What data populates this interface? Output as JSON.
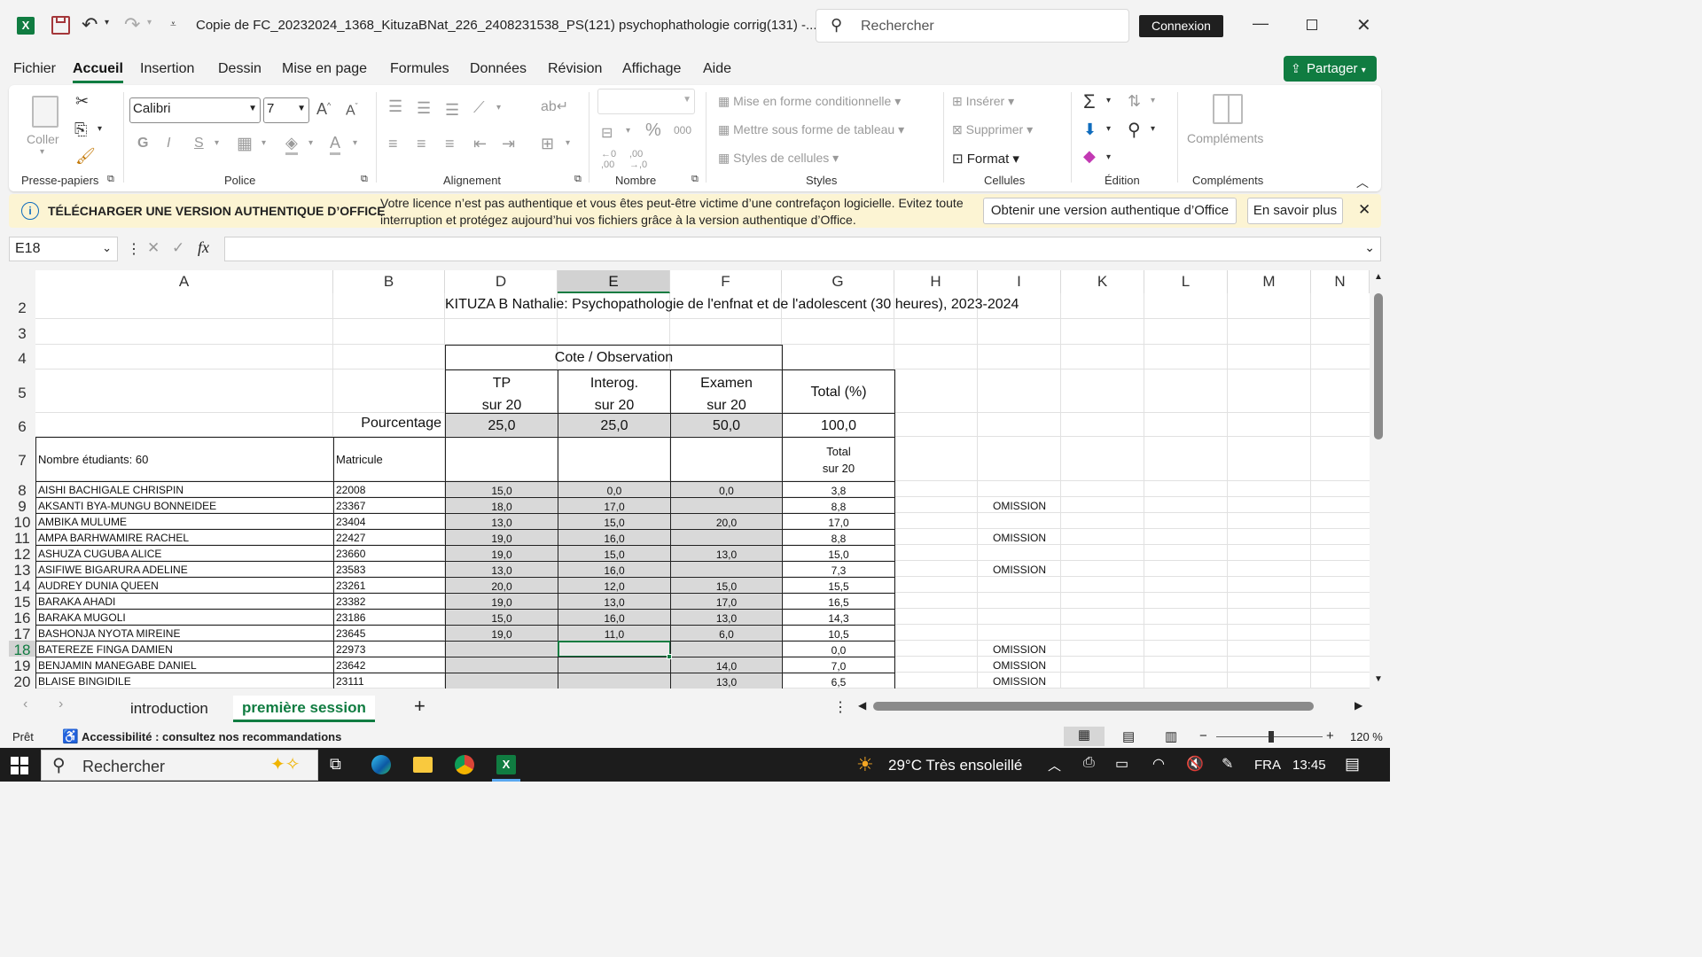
{
  "app": {
    "title": "Copie de FC_20232024_1368_KituzaBNat_226_2408231538_PS(121) psychophathologie corrig(131)  -...",
    "search_placeholder": "Rechercher",
    "signin": "Connexion"
  },
  "menu": [
    "Fichier",
    "Accueil",
    "Insertion",
    "Dessin",
    "Mise en page",
    "Formules",
    "Données",
    "Révision",
    "Affichage",
    "Aide"
  ],
  "share": "Partager",
  "ribbon": {
    "paste": "Coller",
    "font_name": "Calibri",
    "font_size": "7",
    "cond_format": "Mise en forme conditionnelle",
    "table_format": "Mettre sous forme de tableau",
    "cell_styles": "Styles de cellules",
    "insert": "Insérer",
    "delete": "Supprimer",
    "format": "Format",
    "addins": "Compléments",
    "groups": {
      "clipboard": "Presse-papiers",
      "font": "Police",
      "alignment": "Alignement",
      "number": "Nombre",
      "styles": "Styles",
      "cells": "Cellules",
      "editing": "Édition",
      "addins": "Compléments"
    }
  },
  "notice": {
    "title": "TÉLÉCHARGER UNE VERSION AUTHENTIQUE D’OFFICE",
    "message": "Votre licence n’est pas authentique et vous êtes peut-être victime d’une contrefaçon logicielle. Evitez toute interruption et protégez aujourd’hui vos fichiers grâce à la version authentique d’Office.",
    "btn_get": "Obtenir une version authentique d’Office",
    "btn_more": "En savoir plus"
  },
  "namebox": "E18",
  "columns": [
    "A",
    "B",
    "D",
    "E",
    "F",
    "G",
    "H",
    "I",
    "K",
    "L",
    "M",
    "N"
  ],
  "row_numbers": [
    "2",
    "3",
    "4",
    "5",
    "6",
    "7",
    "8",
    "9",
    "10",
    "11",
    "12",
    "13",
    "14",
    "15",
    "16",
    "17",
    "18",
    "19",
    "20"
  ],
  "sheet": {
    "title": "KITUZA B Nathalie: Psychopathologie de l'enfnat et de l'adolescent (30 heures), 2023-2024",
    "cote_header": "Cote / Observation",
    "tp_1": "TP",
    "tp_2": "sur 20",
    "interog_1": "Interog.",
    "interog_2": "sur 20",
    "examen_1": "Examen",
    "examen_2": "sur 20",
    "total_pct": "Total (%)",
    "pourcentage_label": "Pourcentage",
    "pct_tp": "25,0",
    "pct_interog": "25,0",
    "pct_examen": "50,0",
    "pct_total": "100,0",
    "nb_etudiants": "Nombre étudiants: 60",
    "matricule": "Matricule",
    "total_1": "Total",
    "total_2": "sur 20",
    "students": [
      {
        "name": "AISHI BACHIGALE CHRISPIN",
        "mat": "22008",
        "tp": "15,0",
        "int": "0,0",
        "ex": "0,0",
        "tot": "3,8",
        "obs": ""
      },
      {
        "name": "AKSANTI BYA-MUNGU BONNEIDEE",
        "mat": "23367",
        "tp": "18,0",
        "int": "17,0",
        "ex": "",
        "tot": "8,8",
        "obs": "OMISSION"
      },
      {
        "name": "AMBIKA MULUME",
        "mat": "23404",
        "tp": "13,0",
        "int": "15,0",
        "ex": "20,0",
        "tot": "17,0",
        "obs": ""
      },
      {
        "name": "AMPA BARHWAMIRE RACHEL",
        "mat": "22427",
        "tp": "19,0",
        "int": "16,0",
        "ex": "",
        "tot": "8,8",
        "obs": "OMISSION"
      },
      {
        "name": "ASHUZA CUGUBA ALICE",
        "mat": "23660",
        "tp": "19,0",
        "int": "15,0",
        "ex": "13,0",
        "tot": "15,0",
        "obs": ""
      },
      {
        "name": "ASIFIWE BIGARURA ADELINE",
        "mat": "23583",
        "tp": "13,0",
        "int": "16,0",
        "ex": "",
        "tot": "7,3",
        "obs": "OMISSION"
      },
      {
        "name": "AUDREY DUNIA QUEEN",
        "mat": "23261",
        "tp": "20,0",
        "int": "12,0",
        "ex": "15,0",
        "tot": "15,5",
        "obs": ""
      },
      {
        "name": "BARAKA AHADI",
        "mat": "23382",
        "tp": "19,0",
        "int": "13,0",
        "ex": "17,0",
        "tot": "16,5",
        "obs": ""
      },
      {
        "name": "BARAKA MUGOLI",
        "mat": "23186",
        "tp": "15,0",
        "int": "16,0",
        "ex": "13,0",
        "tot": "14,3",
        "obs": ""
      },
      {
        "name": "BASHONJA NYOTA MIREINE",
        "mat": "23645",
        "tp": "19,0",
        "int": "11,0",
        "ex": "6,0",
        "tot": "10,5",
        "obs": ""
      },
      {
        "name": "BATEREZE FINGA DAMIEN",
        "mat": "22973",
        "tp": "",
        "int": "",
        "ex": "",
        "tot": "0,0",
        "obs": "OMISSION"
      },
      {
        "name": "BENJAMIN MANEGABE DANIEL",
        "mat": "23642",
        "tp": "",
        "int": "",
        "ex": "14,0",
        "tot": "7,0",
        "obs": "OMISSION"
      },
      {
        "name": "BLAISE BINGIDILE",
        "mat": "23111",
        "tp": "",
        "int": "",
        "ex": "13,0",
        "tot": "6,5",
        "obs": "OMISSION"
      }
    ]
  },
  "tabs": [
    "introduction",
    "première session"
  ],
  "status": {
    "ready": "Prêt",
    "accessibility": "Accessibilité : consultez nos recommandations",
    "zoom": "120 %"
  },
  "taskbar": {
    "search": "Rechercher",
    "weather": "29°C  Très ensoleillé",
    "lang": "FRA",
    "time": "13:45"
  },
  "colors": {
    "excel_green": "#107c41",
    "grey_cell": "#d9d9d9",
    "notice_bg": "#fcf4d3"
  }
}
